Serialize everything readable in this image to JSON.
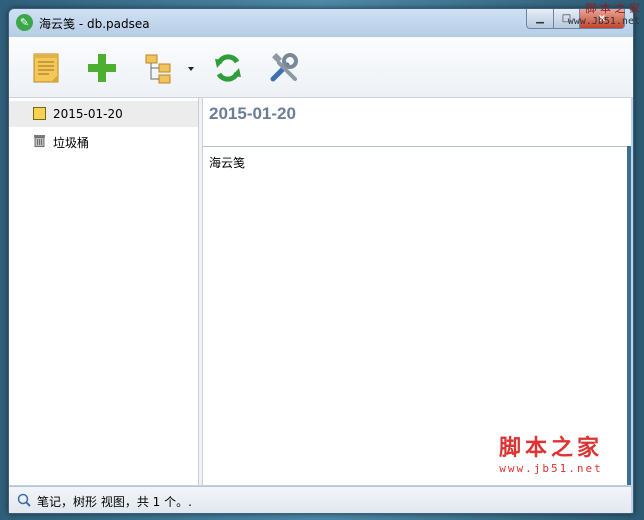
{
  "window": {
    "title": "海云笺 - db.padsea",
    "controls": {
      "minimize": "▁",
      "maximize": "□",
      "close": "x"
    }
  },
  "watermark": {
    "top_cn": "脚 本 之 家",
    "top_url": "www.Jb51.net",
    "bottom_cn": "脚本之家",
    "bottom_url": "www.jb51.net"
  },
  "toolbar": {
    "icons": [
      "notepad-icon",
      "add-icon",
      "tree-view-icon",
      "refresh-icon",
      "tools-icon"
    ],
    "colors": {
      "add": "#4caf30",
      "refresh": "#2e9e3a",
      "notepad": "#f0c24a"
    }
  },
  "tree": {
    "items": [
      {
        "label": "2015-01-20",
        "icon": "note-icon",
        "selected": true
      },
      {
        "label": "垃圾桶",
        "icon": "trash-icon",
        "selected": false
      }
    ]
  },
  "note": {
    "title": "2015-01-20",
    "body": "海云笺"
  },
  "status": {
    "text": "笔记，树形 视图，共 1 个。."
  }
}
